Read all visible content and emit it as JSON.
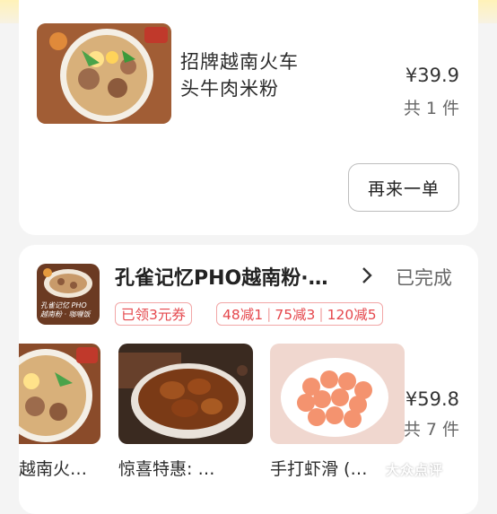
{
  "order1": {
    "item_name_line1": "招牌越南火车",
    "item_name_line2": "头牛肉米粉",
    "price": "¥39.9",
    "quantity": "共 1 件",
    "reorder_label": "再来一单"
  },
  "order2": {
    "shop_name": "孔雀记忆PHO越南粉·…",
    "status": "已完成",
    "logo_text_line1": "孔雀记忆 PHO",
    "logo_text_line2": "越南粉 · 咖喱饭",
    "coupon_tag": "已领3元券",
    "discounts": [
      "48减1",
      "75减3",
      "120减5"
    ],
    "items": [
      {
        "caption": "越南火…"
      },
      {
        "caption": "惊喜特惠: …"
      },
      {
        "caption": "手打虾滑 (…"
      }
    ],
    "price": "¥59.8",
    "quantity": "共 7 件"
  },
  "watermark": "大众点评",
  "colors": {
    "accent_red": "#e5484d",
    "page_bg": "#f4f4f4"
  }
}
